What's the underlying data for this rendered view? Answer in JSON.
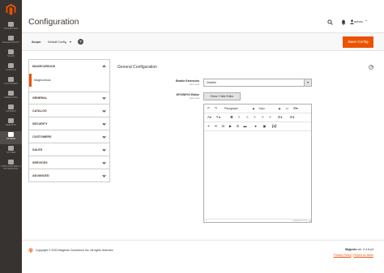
{
  "sidebar": {
    "items": [
      {
        "label": "DASHBOARD",
        "icon": "dashboard-icon"
      },
      {
        "label": "MAGECURIOUS",
        "icon": "magecurious-icon"
      },
      {
        "label": "SALES",
        "icon": "dollar-icon"
      },
      {
        "label": "CATALOG",
        "icon": "cube-icon"
      },
      {
        "label": "CUSTOMERS",
        "icon": "person-icon"
      },
      {
        "label": "MARKETING",
        "icon": "megaphone-icon"
      },
      {
        "label": "CONTENT",
        "icon": "layout-icon"
      },
      {
        "label": "REPORTS",
        "icon": "bar-chart-icon"
      },
      {
        "label": "STORES",
        "icon": "store-icon"
      },
      {
        "label": "SYSTEM",
        "icon": "gear-icon"
      },
      {
        "label": "FIND PARTNERS & EXTENSIONS",
        "icon": "puzzle-icon"
      }
    ],
    "active_index": 8
  },
  "header": {
    "title": "Configuration",
    "user": "admin"
  },
  "scope": {
    "label": "Scope:",
    "value": "Default Config",
    "help": "?"
  },
  "actions": {
    "save_label": "Save Config"
  },
  "tabs": {
    "groups": [
      "MAGECURIOUS",
      "GENERAL",
      "CATALOG",
      "SECURITY",
      "CUSTOMERS",
      "SALES",
      "SERVICES",
      "ADVANCED"
    ],
    "sub_item": "Magecurious"
  },
  "section": {
    "title": "General Configuration",
    "fields": [
      {
        "label": "Enable Extension",
        "scope": "[store view]",
        "value": "Disable"
      },
      {
        "label": "WYSIWYG Editor",
        "scope": "[store view]",
        "button": "Show / Hide Editor"
      }
    ]
  },
  "editor": {
    "format": "Paragraph",
    "size": "14px",
    "path": "P",
    "powered": "POWERED BY TINY"
  },
  "footer": {
    "copyright": "Copyright © 2023 Magento Commerce Inc. All rights reserved.",
    "version_brand": "Magento",
    "version": "ver. 2.4.6-p3",
    "privacy": "Privacy Policy",
    "report": "Report an Issue"
  },
  "colors": {
    "accent": "#eb5202",
    "sidebar": "#373330"
  }
}
